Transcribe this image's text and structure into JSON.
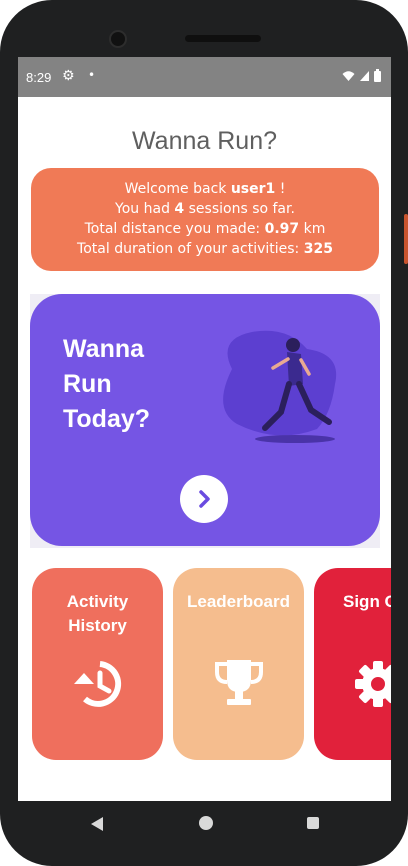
{
  "status_bar": {
    "time": "8:29",
    "settings_icon": "gear-icon",
    "notification_dot": "•",
    "icons": [
      "wifi-icon",
      "signal-icon",
      "battery-icon"
    ]
  },
  "app": {
    "title": "Wanna Run?"
  },
  "welcome": {
    "prefix": "Welcome back ",
    "username": "user1",
    "suffix": " !",
    "sessions_prefix": "You had ",
    "sessions_count": "4",
    "sessions_suffix": " sessions so far.",
    "distance_prefix": "Total distance you made: ",
    "distance_value": "0.97",
    "distance_unit": " km",
    "duration_prefix": "Total duration of your activities: ",
    "duration_value": "325"
  },
  "hero": {
    "line1": "Wanna",
    "line2": "Run",
    "line3": "Today?",
    "illustration": "runner-illustration",
    "arrow_icon": "chevron-right-icon"
  },
  "tiles": [
    {
      "label_line1": "Activity",
      "label_line2": "History",
      "icon": "history-icon"
    },
    {
      "label_line1": "Leaderboard",
      "icon": "trophy-icon"
    },
    {
      "label_line1": "Sign Out",
      "icon": "gear-icon"
    }
  ],
  "colors": {
    "welcome": "#f07a56",
    "hero": "#7555e4",
    "activity_tile": "#ef6f5d",
    "leaderboard_tile": "#f5bd8e",
    "signout_tile": "#e1213b"
  }
}
